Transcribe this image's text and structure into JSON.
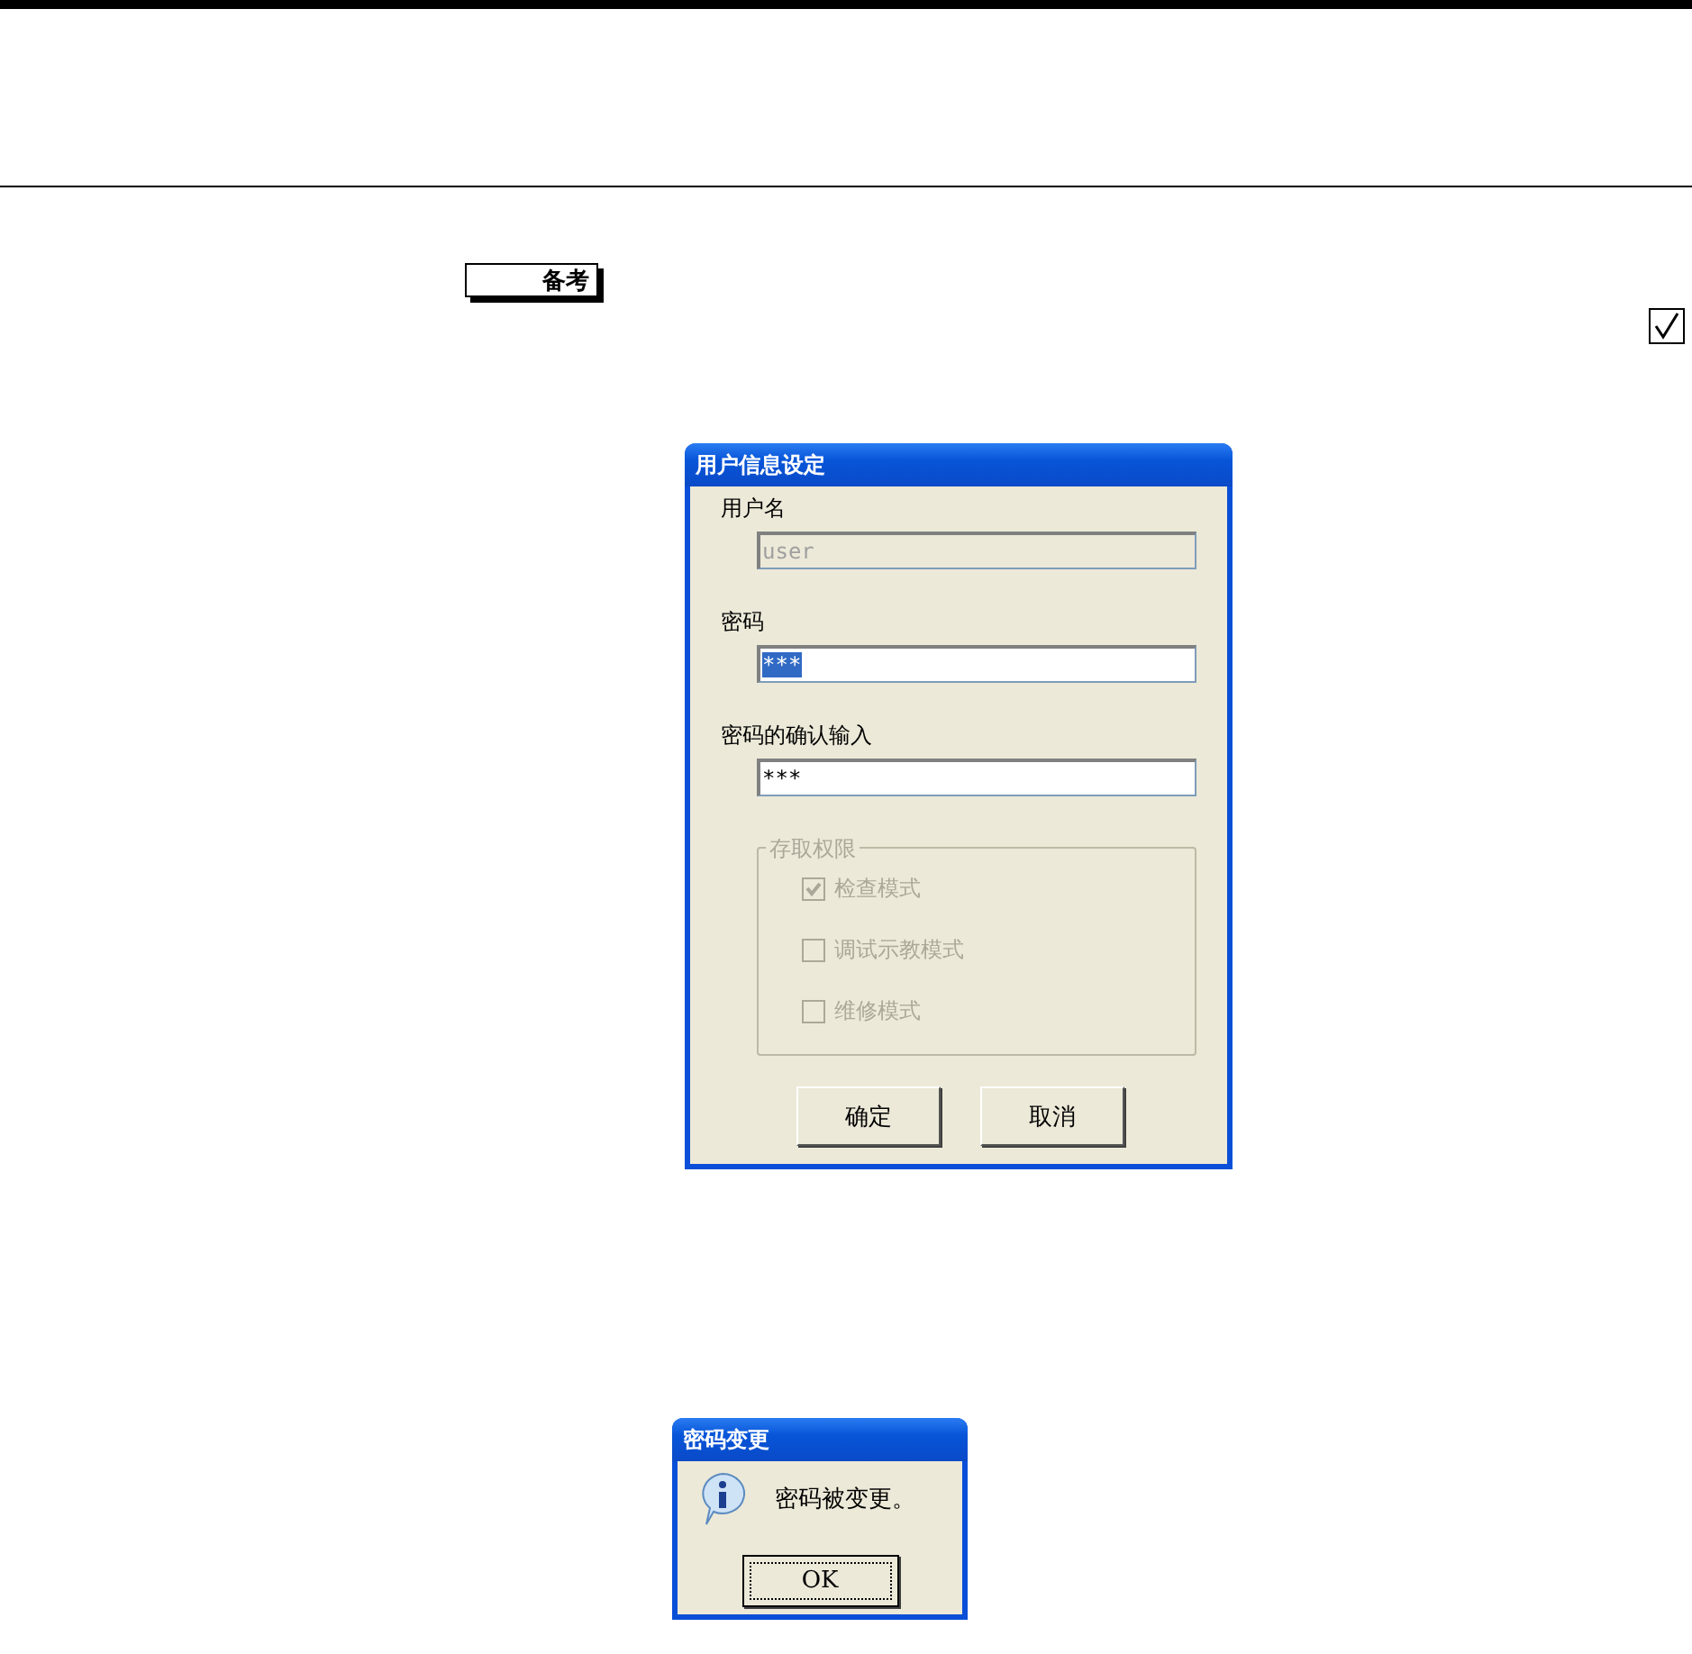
{
  "note_label": "备考",
  "checkmark": {
    "checked": true
  },
  "user_dialog": {
    "title": "用户信息设定",
    "fields": [
      {
        "label": "用户名",
        "value": "user",
        "disabled": true,
        "highlighted": false
      },
      {
        "label": "密码",
        "value": "***",
        "disabled": false,
        "highlighted": true
      },
      {
        "label": "密码的确认输入",
        "value": "***",
        "disabled": false,
        "highlighted": false
      }
    ],
    "group": {
      "title": "存取权限",
      "disabled": true,
      "options": [
        {
          "label": "检查模式",
          "checked": true
        },
        {
          "label": "调试示教模式",
          "checked": false
        },
        {
          "label": "维修模式",
          "checked": false
        }
      ]
    },
    "buttons": [
      "确定",
      "取消"
    ]
  },
  "message_dialog": {
    "title": "密码变更",
    "message": "密码被变更。",
    "button": "OK"
  }
}
